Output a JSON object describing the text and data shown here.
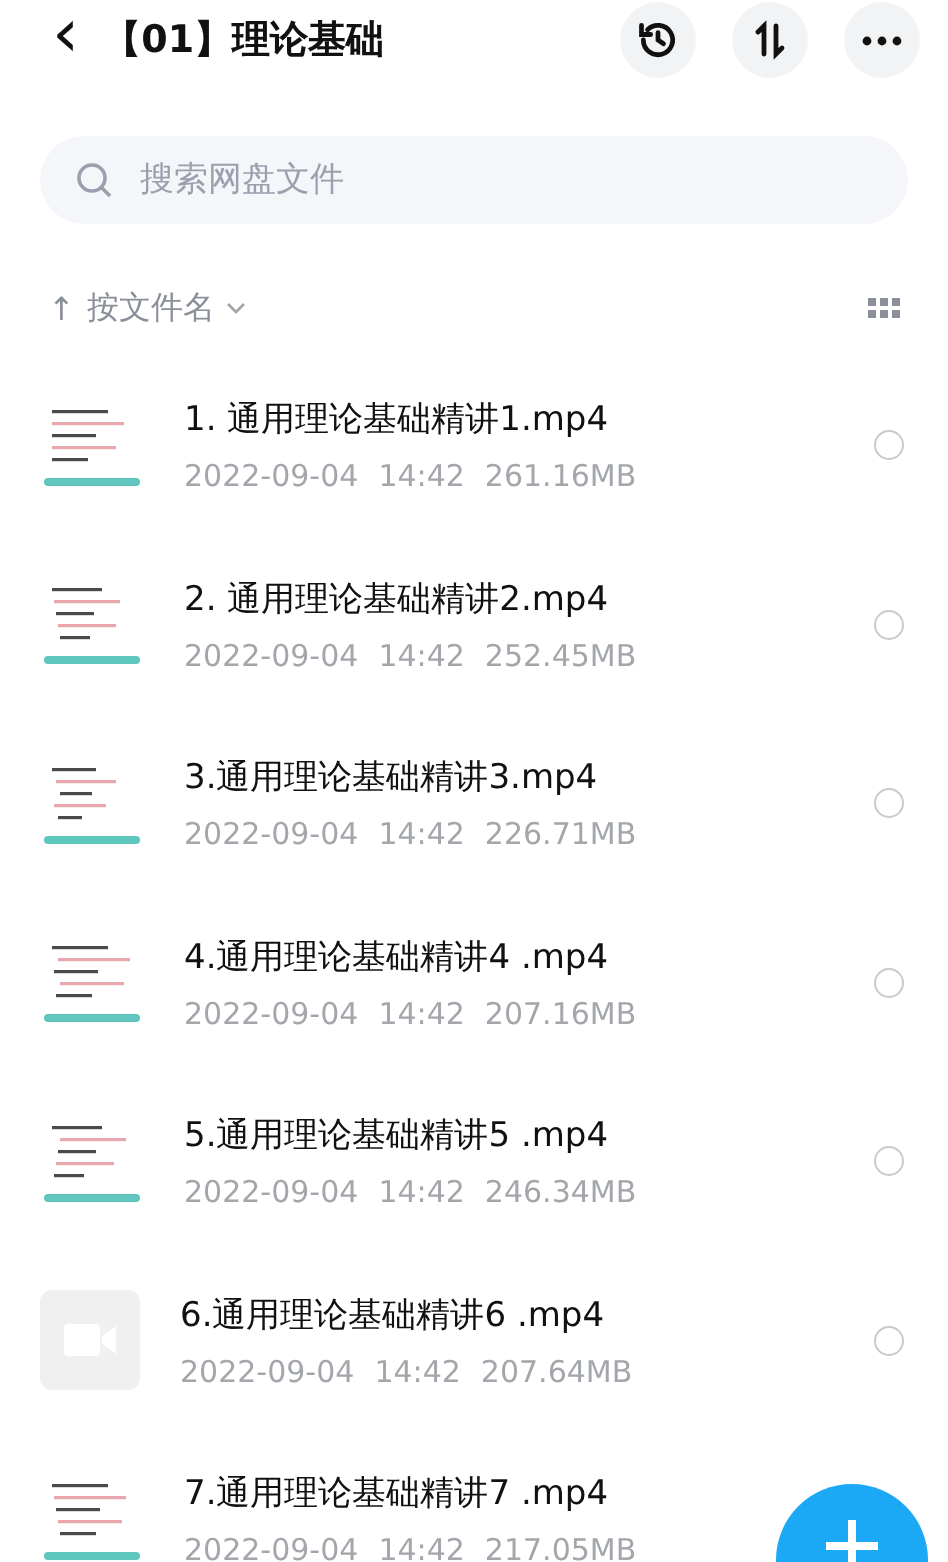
{
  "header": {
    "back": "‹",
    "title": "【01】理论基础"
  },
  "search": {
    "placeholder": "搜索网盘文件"
  },
  "sort": {
    "arrow": "↑",
    "label": "按文件名"
  },
  "files": [
    {
      "name": "1. 通用理论基础精讲1.mp4",
      "date": "2022-09-04",
      "time": "14:42",
      "size": "261.16MB",
      "selected": false
    },
    {
      "name": "2. 通用理论基础精讲2.mp4",
      "date": "2022-09-04",
      "time": "14:42",
      "size": "252.45MB",
      "selected": false
    },
    {
      "name": "3.通用理论基础精讲3.mp4",
      "date": "2022-09-04",
      "time": "14:42",
      "size": "226.71MB",
      "selected": false
    },
    {
      "name": "4.通用理论基础精讲4 .mp4",
      "date": "2022-09-04",
      "time": "14:42",
      "size": "207.16MB",
      "selected": false
    },
    {
      "name": "5.通用理论基础精讲5 .mp4",
      "date": "2022-09-04",
      "time": "14:42",
      "size": "246.34MB",
      "selected": false
    },
    {
      "name": "6.通用理论基础精讲6 .mp4",
      "date": "2022-09-04",
      "time": "14:42",
      "size": "207.64MB",
      "thumb": {
        "kind": "video"
      },
      "selected": false
    },
    {
      "name": "7.通用理论基础精讲7 .mp4",
      "date": "2022-09-04",
      "time": "14:42",
      "size": "217.05MB"
    }
  ]
}
